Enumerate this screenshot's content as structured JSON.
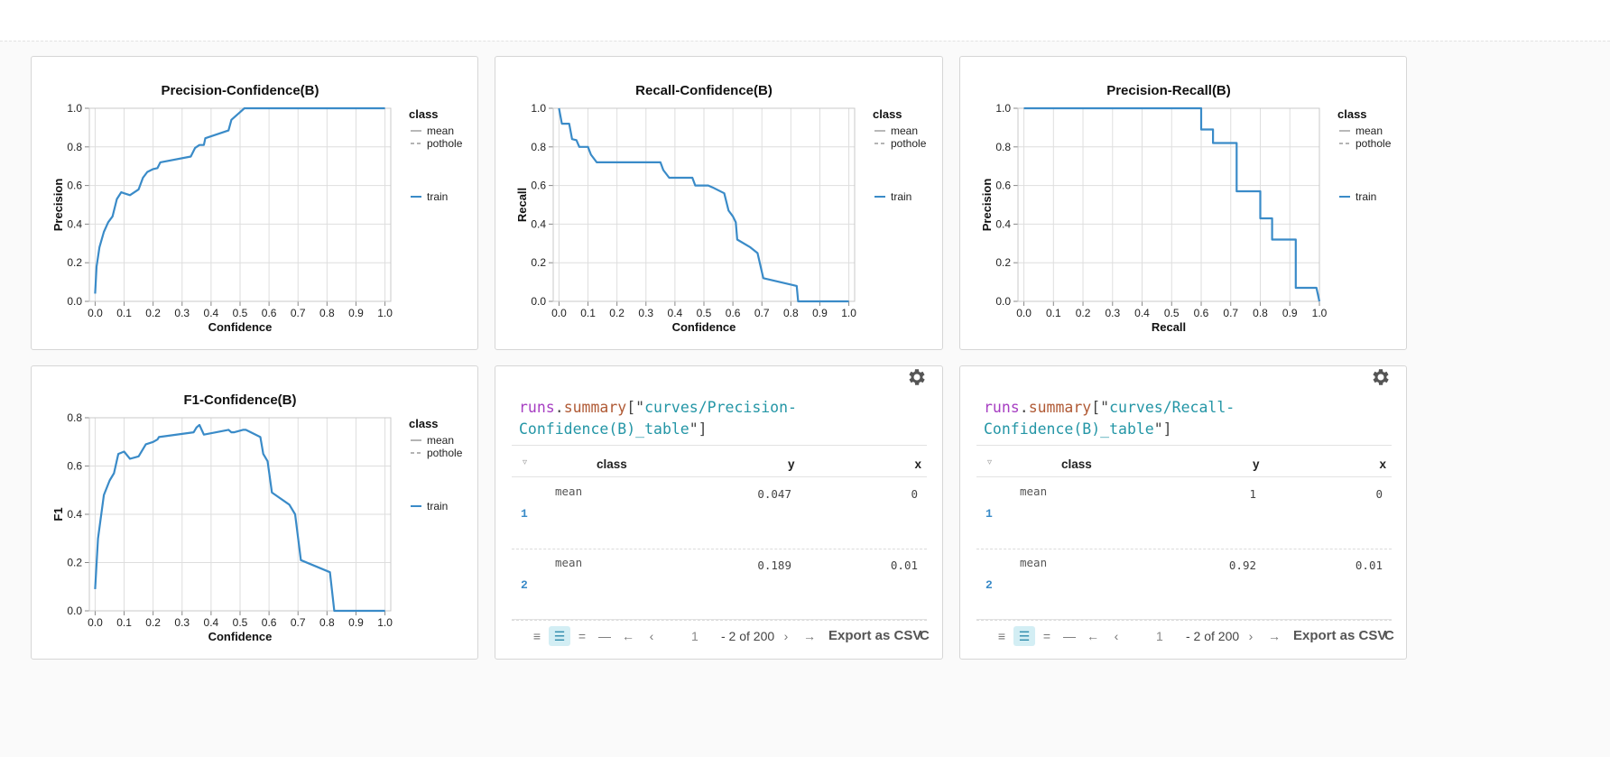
{
  "charts": [
    {
      "id": "pc",
      "title": "Precision-Confidence(B)",
      "xlabel": "Confidence",
      "ylabel": "Precision",
      "xticks": [
        "0.0",
        "0.1",
        "0.2",
        "0.3",
        "0.4",
        "0.5",
        "0.6",
        "0.7",
        "0.8",
        "0.9",
        "1.0"
      ],
      "yticks": [
        "0.0",
        "0.2",
        "0.4",
        "0.6",
        "0.8",
        "1.0"
      ],
      "legend": {
        "title": "class",
        "items": [
          "mean",
          "pothole"
        ],
        "series": "train"
      }
    },
    {
      "id": "rc",
      "title": "Recall-Confidence(B)",
      "xlabel": "Confidence",
      "ylabel": "Recall",
      "xticks": [
        "0.0",
        "0.1",
        "0.2",
        "0.3",
        "0.4",
        "0.5",
        "0.6",
        "0.7",
        "0.8",
        "0.9",
        "1.0"
      ],
      "yticks": [
        "0.0",
        "0.2",
        "0.4",
        "0.6",
        "0.8",
        "1.0"
      ],
      "legend": {
        "title": "class",
        "items": [
          "mean",
          "pothole"
        ],
        "series": "train"
      }
    },
    {
      "id": "pr",
      "title": "Precision-Recall(B)",
      "xlabel": "Recall",
      "ylabel": "Precision",
      "xticks": [
        "0.0",
        "0.1",
        "0.2",
        "0.3",
        "0.4",
        "0.5",
        "0.6",
        "0.7",
        "0.8",
        "0.9",
        "1.0"
      ],
      "yticks": [
        "0.0",
        "0.2",
        "0.4",
        "0.6",
        "0.8",
        "1.0"
      ],
      "legend": {
        "title": "class",
        "items": [
          "mean",
          "pothole"
        ],
        "series": "train"
      }
    },
    {
      "id": "f1",
      "title": "F1-Confidence(B)",
      "xlabel": "Confidence",
      "ylabel": "F1",
      "xticks": [
        "0.0",
        "0.1",
        "0.2",
        "0.3",
        "0.4",
        "0.5",
        "0.6",
        "0.7",
        "0.8",
        "0.9",
        "1.0"
      ],
      "yticks": [
        "0.0",
        "0.2",
        "0.4",
        "0.6",
        "0.8"
      ],
      "legend": {
        "title": "class",
        "items": [
          "mean",
          "pothole"
        ],
        "series": "train"
      }
    }
  ],
  "chart_data": [
    {
      "type": "line",
      "title": "Precision-Confidence(B)",
      "xlabel": "Confidence",
      "ylabel": "Precision",
      "xlim": [
        -0.02,
        1.02
      ],
      "ylim": [
        0,
        1
      ],
      "grid": true,
      "legend_position": "right",
      "series": [
        {
          "name": "train",
          "color": "#3a8bc8",
          "x": [
            0.0,
            0.005,
            0.015,
            0.03,
            0.045,
            0.06,
            0.075,
            0.09,
            0.1,
            0.12,
            0.15,
            0.165,
            0.18,
            0.2,
            0.215,
            0.225,
            0.33,
            0.345,
            0.36,
            0.375,
            0.38,
            0.46,
            0.47,
            0.5,
            0.515,
            0.53,
            1.0
          ],
          "y": [
            0.04,
            0.18,
            0.28,
            0.36,
            0.41,
            0.44,
            0.53,
            0.565,
            0.56,
            0.55,
            0.58,
            0.64,
            0.67,
            0.685,
            0.69,
            0.72,
            0.75,
            0.795,
            0.81,
            0.81,
            0.845,
            0.885,
            0.94,
            0.98,
            1.0,
            1.0,
            1.0
          ]
        }
      ]
    },
    {
      "type": "line",
      "title": "Recall-Confidence(B)",
      "xlabel": "Confidence",
      "ylabel": "Recall",
      "xlim": [
        -0.02,
        1.02
      ],
      "ylim": [
        0,
        1
      ],
      "grid": true,
      "legend_position": "right",
      "series": [
        {
          "name": "train",
          "color": "#3a8bc8",
          "x": [
            0.0,
            0.01,
            0.02,
            0.035,
            0.045,
            0.06,
            0.07,
            0.1,
            0.11,
            0.13,
            0.35,
            0.36,
            0.38,
            0.46,
            0.47,
            0.5,
            0.515,
            0.53,
            0.57,
            0.585,
            0.6,
            0.61,
            0.615,
            0.66,
            0.685,
            0.705,
            0.82,
            0.825,
            1.0
          ],
          "y": [
            1.0,
            0.92,
            0.92,
            0.92,
            0.84,
            0.835,
            0.8,
            0.8,
            0.76,
            0.72,
            0.72,
            0.68,
            0.64,
            0.64,
            0.6,
            0.6,
            0.6,
            0.59,
            0.56,
            0.47,
            0.44,
            0.41,
            0.32,
            0.28,
            0.25,
            0.12,
            0.08,
            0.0,
            0.0
          ]
        }
      ]
    },
    {
      "type": "line",
      "title": "Precision-Recall(B)",
      "xlabel": "Recall",
      "ylabel": "Precision",
      "xlim": [
        -0.02,
        1.0
      ],
      "ylim": [
        0,
        1
      ],
      "grid": true,
      "legend_position": "right",
      "series": [
        {
          "name": "train",
          "color": "#3a8bc8",
          "x": [
            0.0,
            0.6,
            0.6,
            0.64,
            0.64,
            0.72,
            0.72,
            0.8,
            0.8,
            0.84,
            0.84,
            0.92,
            0.92,
            0.99,
            1.0
          ],
          "y": [
            1.0,
            1.0,
            0.89,
            0.89,
            0.82,
            0.82,
            0.57,
            0.57,
            0.43,
            0.43,
            0.32,
            0.32,
            0.07,
            0.07,
            0.0
          ]
        }
      ]
    },
    {
      "type": "line",
      "title": "F1-Confidence(B)",
      "xlabel": "Confidence",
      "ylabel": "F1",
      "xlim": [
        -0.02,
        1.02
      ],
      "ylim": [
        0,
        0.8
      ],
      "grid": true,
      "legend_position": "right",
      "series": [
        {
          "name": "train",
          "color": "#3a8bc8",
          "x": [
            0.0,
            0.01,
            0.03,
            0.05,
            0.065,
            0.08,
            0.1,
            0.12,
            0.15,
            0.175,
            0.2,
            0.215,
            0.22,
            0.34,
            0.35,
            0.36,
            0.375,
            0.46,
            0.47,
            0.48,
            0.51,
            0.52,
            0.57,
            0.58,
            0.595,
            0.61,
            0.67,
            0.69,
            0.71,
            0.81,
            0.825,
            1.0
          ],
          "y": [
            0.09,
            0.3,
            0.48,
            0.54,
            0.57,
            0.65,
            0.66,
            0.63,
            0.64,
            0.69,
            0.7,
            0.71,
            0.72,
            0.74,
            0.76,
            0.77,
            0.73,
            0.75,
            0.74,
            0.74,
            0.75,
            0.75,
            0.72,
            0.65,
            0.62,
            0.49,
            0.44,
            0.4,
            0.21,
            0.16,
            0.0,
            0.0
          ]
        }
      ]
    }
  ],
  "tables": [
    {
      "expr_obj": "runs",
      "expr_dot": ".",
      "expr_fn": "summary",
      "expr_open": "[\"",
      "expr_key": "curves/Precision-Confidence(B)_table",
      "expr_close": "\"]",
      "columns": [
        "class",
        "y",
        "x"
      ],
      "rows": [
        {
          "idx": "1",
          "class": "mean",
          "y": "0.047",
          "x": "0"
        },
        {
          "idx": "2",
          "class": "mean",
          "y": "0.189",
          "x": "0.01"
        }
      ],
      "page_input": "1",
      "page_of": "- 2 of 200",
      "export": "Export as CSV",
      "trailing": "C"
    },
    {
      "expr_obj": "runs",
      "expr_dot": ".",
      "expr_fn": "summary",
      "expr_open": "[\"",
      "expr_key": "curves/Recall-Confidence(B)_table",
      "expr_close": "\"]",
      "columns": [
        "class",
        "y",
        "x"
      ],
      "rows": [
        {
          "idx": "1",
          "class": "mean",
          "y": "1",
          "x": "0"
        },
        {
          "idx": "2",
          "class": "mean",
          "y": "0.92",
          "x": "0.01"
        }
      ],
      "page_input": "1",
      "page_of": "- 2 of 200",
      "export": "Export as CSV",
      "trailing": "C"
    }
  ],
  "icons": {
    "gear": "gear-icon",
    "filter": "filter-icon",
    "toolbar": [
      "rows-compact-icon",
      "rows-normal-icon",
      "rows-tall-icon",
      "rows-min-icon",
      "arrow-left-icon",
      "chevron-left-icon",
      "chevron-right-icon",
      "arrow-right-icon"
    ]
  },
  "colors": {
    "series": "#3a8bc8",
    "accent_active": "#d3eef4",
    "row_index": "#3a8bc8"
  }
}
